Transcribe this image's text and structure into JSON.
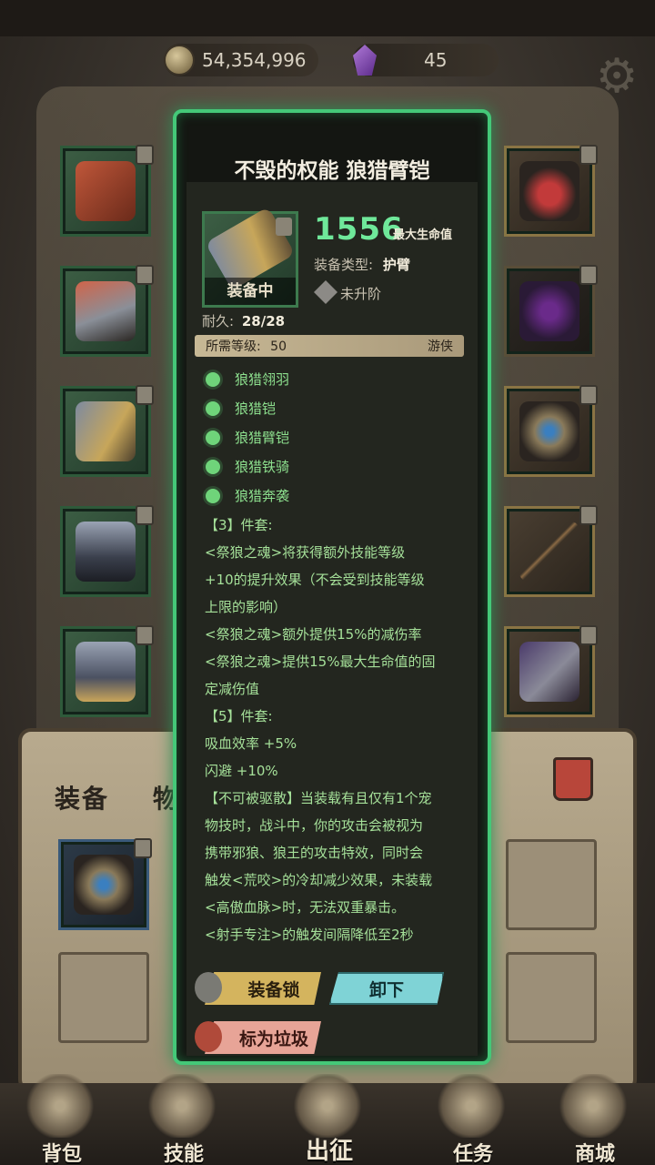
{
  "currency": {
    "gold": "54,354,996",
    "gems": "45"
  },
  "sections": {
    "equipment": "装备",
    "items": "物品"
  },
  "item": {
    "title": "不毁的权能 狼猎臂铠",
    "equipped_label": "装备中",
    "stat_value": "1556",
    "stat_name": "最大生命值",
    "type_label": "装备类型:",
    "type_value": "护臂",
    "upgrade_status": "未升阶",
    "durability_label": "耐久:",
    "durability_value": "28/28",
    "level_label": "所需等级:",
    "level_value": "50",
    "class": "游侠"
  },
  "set_items": [
    "狼猎翎羽",
    "狼猎铠",
    "狼猎臂铠",
    "狼猎铁骑",
    "狼猎奔袭"
  ],
  "description": [
    "【3】件套:",
    "<祭狼之魂>将获得额外技能等级",
    "+10的提升效果（不会受到技能等级",
    "上限的影响）",
    "<祭狼之魂>额外提供15%的减伤率",
    "<祭狼之魂>提供15%最大生命值的固",
    "定减伤值",
    "【5】件套:",
    "吸血效率 +5%",
    "闪避 +10%",
    "【不可被驱散】当装载有且仅有1个宠",
    "物技时，战斗中，你的攻击会被视为",
    "携带邪狼、狼王的攻击特效，同时会",
    "触发<荒咬>的冷却减少效果，未装载",
    "<高傲血脉>时，无法双重暴击。",
    "<射手专注>的触发间隔降低至2秒"
  ],
  "buttons": {
    "lock": "装备锁",
    "unequip": "卸下",
    "junk": "标为垃圾"
  },
  "nav": [
    "背包",
    "技能",
    "出征",
    "任务",
    "商城"
  ],
  "icons": {
    "gold": "coin-icon",
    "gems": "purple-gem-icon",
    "settings": "gear-icon",
    "trash": "trash-can-icon"
  }
}
